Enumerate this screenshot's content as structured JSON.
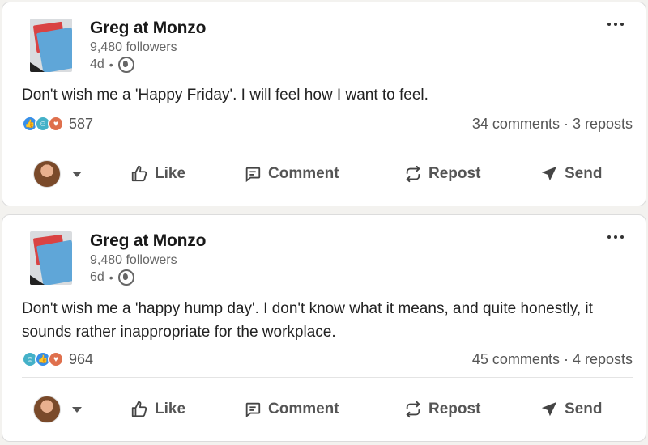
{
  "posts": [
    {
      "author": {
        "name": "Greg at Monzo",
        "followers": "9,480 followers",
        "age": "4d",
        "visibility_icon": "globe-icon"
      },
      "text": "Don't wish me a 'Happy Friday'. I will feel how I want to feel.",
      "reactions": {
        "icons": [
          "like-reaction-icon",
          "funny-reaction-icon",
          "love-reaction-icon"
        ],
        "count": "587"
      },
      "comments_reposts": "34 comments · 3 reposts",
      "actions": {
        "like": "Like",
        "comment": "Comment",
        "repost": "Repost",
        "send": "Send"
      }
    },
    {
      "author": {
        "name": "Greg at Monzo",
        "followers": "9,480 followers",
        "age": "6d",
        "visibility_icon": "globe-icon"
      },
      "text": "Don't wish me a 'happy hump day'. I don't know what it means, and quite honestly, it sounds rather inappropriate for the workplace.",
      "reactions": {
        "icons": [
          "funny-reaction-icon",
          "like-reaction-icon",
          "love-reaction-icon"
        ],
        "count": "964"
      },
      "comments_reposts": "45 comments · 4 reposts",
      "actions": {
        "like": "Like",
        "comment": "Comment",
        "repost": "Repost",
        "send": "Send"
      }
    }
  ],
  "colors": {
    "page_bg": "#f3f2ef",
    "card_bg": "#ffffff",
    "like_blue": "#378fe9",
    "funny_teal": "#44b1c8",
    "love_orange": "#df704d"
  }
}
